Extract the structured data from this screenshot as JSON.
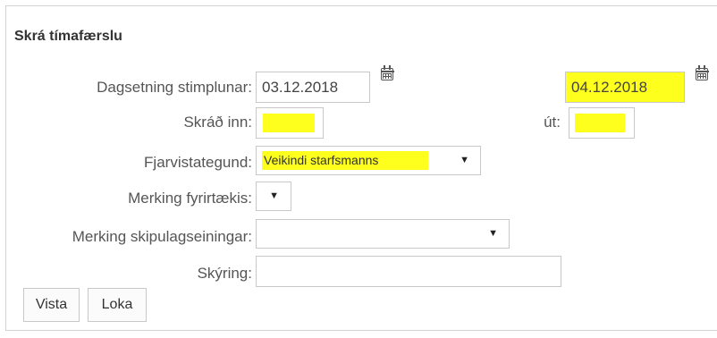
{
  "dialog": {
    "title": "Skrá tímafærslu",
    "labels": {
      "date": "Dagsetning stimplunar:",
      "checked_in": "Skráð inn:",
      "out": "út:",
      "absence_type": "Fjarvistategund:",
      "company_marking": "Merking fyrirtækis:",
      "org_unit_marking": "Merking skipulagseiningar:",
      "explanation": "Skýring:"
    },
    "fields": {
      "date_from": "03.12.2018",
      "date_to": "04.12.2018",
      "checked_in": "",
      "out": "",
      "absence_type": "Veikindi starfsmanns",
      "company_marking": "",
      "org_unit_marking": "",
      "explanation": ""
    },
    "buttons": {
      "save": "Vista",
      "close": "Loka"
    }
  },
  "colors": {
    "highlight": "#ffff1e",
    "border": "#c8c8c8"
  }
}
